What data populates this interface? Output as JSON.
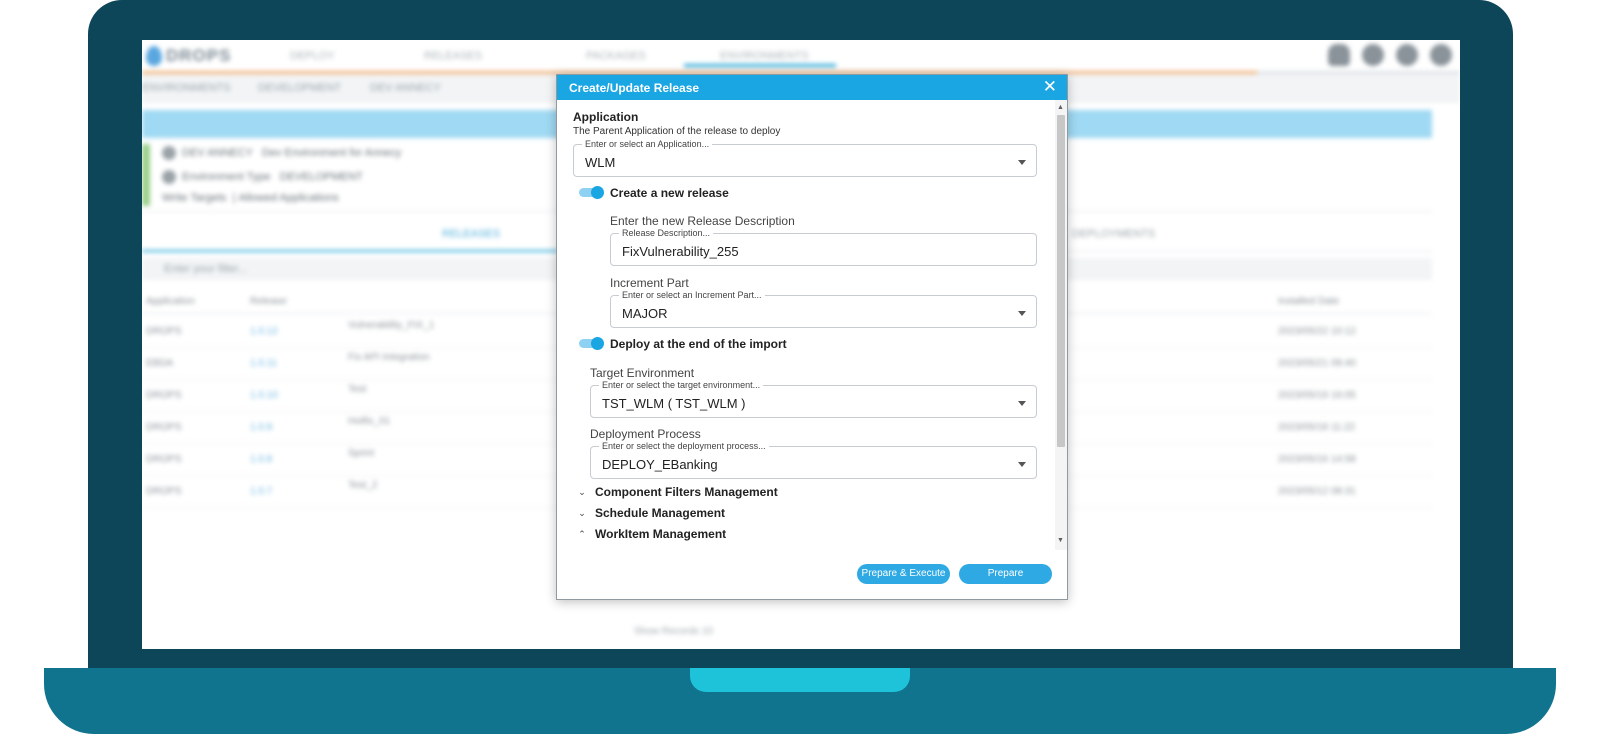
{
  "background_app": {
    "logo_text": "DROPS",
    "nav": [
      "DEPLOY",
      "RELEASES",
      "PACKAGES",
      "ENVIRONMENTS"
    ],
    "breadcrumb": [
      "ENVIRONMENTS",
      "DEVELOPMENT",
      "DEV ANNECY"
    ],
    "env_name": "DEV ANNECY",
    "env_desc": "Dev Environment for Annecy",
    "env_type_label": "Environment Type",
    "env_type_value": "DEVELOPMENT",
    "env_links": [
      "Write Targets",
      "Allowed Applications"
    ],
    "tabs": [
      "RELEASES",
      "DEPLOYMENTS"
    ],
    "filter_placeholder": "Enter your filter...",
    "grid_headers": [
      "Application",
      "Release",
      "Installed Date"
    ],
    "grid_rows": [
      {
        "app": "DROPS",
        "release": "1.0.12",
        "desc": "Vulnerability_FIX_1",
        "date": "2023/05/22 10:12"
      },
      {
        "app": "EBDA",
        "release": "1.0.11",
        "desc": "Fix API Integration",
        "date": "2023/05/21 09:40"
      },
      {
        "app": "DROPS",
        "release": "1.0.10",
        "desc": "Test",
        "date": "2023/05/19 16:05"
      },
      {
        "app": "DROPS",
        "release": "1.0.9",
        "desc": "Hotfix_01",
        "date": "2023/05/18 11:22"
      },
      {
        "app": "DROPS",
        "release": "1.0.8",
        "desc": "Sprint",
        "date": "2023/05/16 14:58"
      },
      {
        "app": "DROPS",
        "release": "1.0.7",
        "desc": "Test_2",
        "date": "2023/05/12 08:31"
      }
    ],
    "pager": "Show Records   10"
  },
  "dialog": {
    "title": "Create/Update Release",
    "application": {
      "title": "Application",
      "subtitle": "The Parent Application of the release to deploy",
      "placeholder": "Enter or select an Application...",
      "value": "WLM"
    },
    "create_toggle": {
      "label": "Create a new release",
      "on": true
    },
    "release_description": {
      "label": "Enter the new Release Description",
      "placeholder": "Release Description...",
      "value": "FixVulnerability_255"
    },
    "increment_part": {
      "label": "Increment Part",
      "placeholder": "Enter or select an Increment Part...",
      "value": "MAJOR"
    },
    "deploy_toggle": {
      "label": "Deploy at the end of the import",
      "on": true
    },
    "target_environment": {
      "label": "Target Environment",
      "placeholder": "Enter or select the target environment...",
      "value": "TST_WLM ( TST_WLM )"
    },
    "deployment_process": {
      "label": "Deployment Process",
      "placeholder": "Enter or select the deployment process...",
      "value": "DEPLOY_EBanking"
    },
    "sections": [
      {
        "label": "Component Filters Management",
        "expanded": false
      },
      {
        "label": "Schedule Management",
        "expanded": false
      },
      {
        "label": "WorkItem Management",
        "expanded": true
      }
    ],
    "buttons": {
      "prepare_execute": "Prepare & Execute",
      "prepare": "Prepare"
    },
    "close_symbol": "✕"
  },
  "colors": {
    "accent": "#1aa6e3",
    "laptop_lid": "#0d4659",
    "laptop_base": "#11748f",
    "laptop_notch": "#1ec2d9"
  }
}
